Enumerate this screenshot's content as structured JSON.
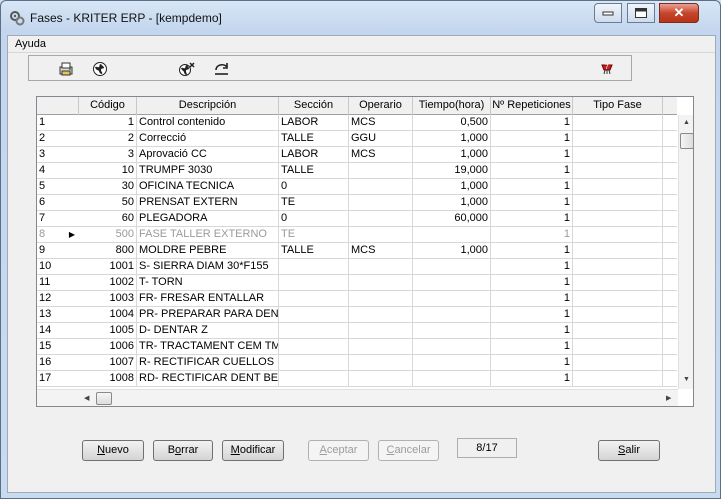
{
  "window": {
    "title": "Fases - KRITER ERP - [kempdemo]"
  },
  "menu": {
    "ayuda": "Ayuda"
  },
  "toolbar": {
    "icons": [
      "print-icon",
      "globe-icon",
      "tools-icon",
      "refresh-icon",
      "help-icon"
    ]
  },
  "grid": {
    "headers": [
      "Código",
      "Descripción",
      "Sección",
      "Operario",
      "Tiempo(hora)",
      "Nº Repeticiones",
      "Tipo Fase"
    ],
    "current_row_marker": "▶",
    "rows": [
      {
        "n": "1",
        "code": "1",
        "desc": "Control contenido",
        "sec": "LABOR",
        "op": "MCS",
        "time": "0,500",
        "rep": "1",
        "tipo": ""
      },
      {
        "n": "2",
        "code": "2",
        "desc": "Correcció",
        "sec": "TALLE",
        "op": "GGU",
        "time": "1,000",
        "rep": "1",
        "tipo": ""
      },
      {
        "n": "3",
        "code": "3",
        "desc": "Aprovació CC",
        "sec": "LABOR",
        "op": "MCS",
        "time": "1,000",
        "rep": "1",
        "tipo": ""
      },
      {
        "n": "4",
        "code": "10",
        "desc": "TRUMPF 3030",
        "sec": "TALLE",
        "op": "",
        "time": "19,000",
        "rep": "1",
        "tipo": ""
      },
      {
        "n": "5",
        "code": "30",
        "desc": "OFICINA TECNICA",
        "sec": "0",
        "op": "",
        "time": "1,000",
        "rep": "1",
        "tipo": ""
      },
      {
        "n": "6",
        "code": "50",
        "desc": "PRENSAT EXTERN",
        "sec": "TE",
        "op": "",
        "time": "1,000",
        "rep": "1",
        "tipo": ""
      },
      {
        "n": "7",
        "code": "60",
        "desc": "PLEGADORA",
        "sec": "0",
        "op": "",
        "time": "60,000",
        "rep": "1",
        "tipo": ""
      },
      {
        "n": "8",
        "code": "500",
        "desc": "FASE TALLER EXTERNO",
        "sec": "TE",
        "op": "",
        "time": "",
        "rep": "1",
        "tipo": ""
      },
      {
        "n": "9",
        "code": "800",
        "desc": "MOLDRE PEBRE",
        "sec": "TALLE",
        "op": "MCS",
        "time": "1,000",
        "rep": "1",
        "tipo": ""
      },
      {
        "n": "10",
        "code": "1001",
        "desc": "S- SIERRA DIAM 30*F155",
        "sec": "",
        "op": "",
        "time": "",
        "rep": "1",
        "tipo": ""
      },
      {
        "n": "11",
        "code": "1002",
        "desc": "T- TORN",
        "sec": "",
        "op": "",
        "time": "",
        "rep": "1",
        "tipo": ""
      },
      {
        "n": "12",
        "code": "1003",
        "desc": "FR- FRESAR ENTALLAR",
        "sec": "",
        "op": "",
        "time": "",
        "rep": "1",
        "tipo": ""
      },
      {
        "n": "13",
        "code": "1004",
        "desc": "PR- PREPARAR PARA DENT",
        "sec": "",
        "op": "",
        "time": "",
        "rep": "1",
        "tipo": ""
      },
      {
        "n": "14",
        "code": "1005",
        "desc": "D- DENTAR Z",
        "sec": "",
        "op": "",
        "time": "",
        "rep": "1",
        "tipo": ""
      },
      {
        "n": "15",
        "code": "1006",
        "desc": "TR- TRACTAMENT CEM TM",
        "sec": "",
        "op": "",
        "time": "",
        "rep": "1",
        "tipo": ""
      },
      {
        "n": "16",
        "code": "1007",
        "desc": "R- RECTIFICAR CUELLOS",
        "sec": "",
        "op": "",
        "time": "",
        "rep": "1",
        "tipo": ""
      },
      {
        "n": "17",
        "code": "1008",
        "desc": "RD- RECTIFICAR DENT BEF",
        "sec": "",
        "op": "",
        "time": "",
        "rep": "1",
        "tipo": ""
      }
    ],
    "selected_row": 8
  },
  "buttons": {
    "nuevo": {
      "u": "N",
      "rest": "uevo"
    },
    "borrar": {
      "pre": "B",
      "u": "o",
      "rest": "rrar"
    },
    "modificar": {
      "u": "M",
      "rest": "odificar"
    },
    "aceptar": {
      "u": "A",
      "rest": "ceptar"
    },
    "cancelar": {
      "u": "C",
      "rest": "ancelar"
    },
    "salir": {
      "u": "S",
      "rest": "alir"
    }
  },
  "record_counter": "8/17"
}
